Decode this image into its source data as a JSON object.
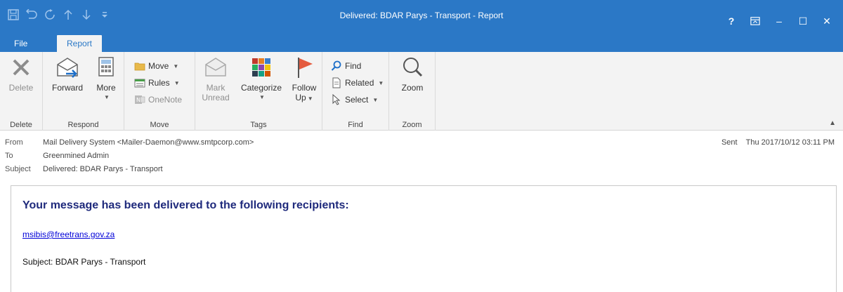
{
  "window": {
    "title": "Delivered: BDAR Parys - Transport - Report",
    "help": "?",
    "minimize": "–",
    "maximize": "☐",
    "close": "✕"
  },
  "quick_access": [
    "save-icon",
    "undo-icon",
    "redo-icon",
    "up-icon",
    "down-icon",
    "customize-icon"
  ],
  "tabs": [
    {
      "label": "File",
      "selected": false
    },
    {
      "label": "Report",
      "selected": true
    }
  ],
  "ribbon": {
    "groups": [
      {
        "label": "Delete",
        "buttons": [
          {
            "label": "Delete",
            "icon": "delete-icon",
            "enabled": false
          }
        ]
      },
      {
        "label": "Respond",
        "buttons": [
          {
            "label": "Forward",
            "icon": "forward-icon",
            "enabled": true
          },
          {
            "label": "More",
            "icon": "more-icon",
            "enabled": true
          }
        ]
      },
      {
        "label": "Move",
        "buttons": [
          {
            "label": "Move",
            "icon": "move-folder-icon",
            "enabled": true
          },
          {
            "label": "Rules",
            "icon": "rules-icon",
            "enabled": true
          },
          {
            "label": "OneNote",
            "icon": "onenote-icon",
            "enabled": false
          }
        ]
      },
      {
        "label": "Tags",
        "buttons": [
          {
            "label": "Mark Unread",
            "line1": "Mark",
            "line2": "Unread",
            "icon": "mark-unread-icon",
            "enabled": false
          },
          {
            "label": "Categorize",
            "icon": "categorize-icon",
            "enabled": true
          },
          {
            "label": "Follow Up",
            "line1": "Follow",
            "line2": "Up",
            "icon": "follow-up-flag-icon",
            "enabled": true
          }
        ]
      },
      {
        "label": "Find",
        "buttons": [
          {
            "label": "Find",
            "icon": "find-icon",
            "enabled": true
          },
          {
            "label": "Related",
            "icon": "related-icon",
            "enabled": true
          },
          {
            "label": "Select",
            "icon": "select-icon",
            "enabled": true
          }
        ]
      },
      {
        "label": "Zoom",
        "buttons": [
          {
            "label": "Zoom",
            "icon": "zoom-icon",
            "enabled": true
          }
        ]
      }
    ]
  },
  "header": {
    "from_label": "From",
    "from_value": "Mail Delivery System <Mailer-Daemon@www.smtpcorp.com>",
    "to_label": "To",
    "to_value": "Greenmined Admin",
    "subject_label": "Subject",
    "subject_value": "Delivered: BDAR Parys - Transport",
    "sent_label": "Sent",
    "sent_value": "Thu 2017/10/12 03:11 PM"
  },
  "body": {
    "heading": "Your message has been delivered to the following recipients:",
    "recipient": "msibis@freetrans.gov.za",
    "subject_line": "Subject: BDAR Parys - Transport"
  },
  "colors": {
    "titlebar": "#2b78c6",
    "ribbon": "#f3f3f3",
    "heading": "#1f2a7c",
    "link": "#0000d8",
    "flag": "#e45b3f"
  }
}
